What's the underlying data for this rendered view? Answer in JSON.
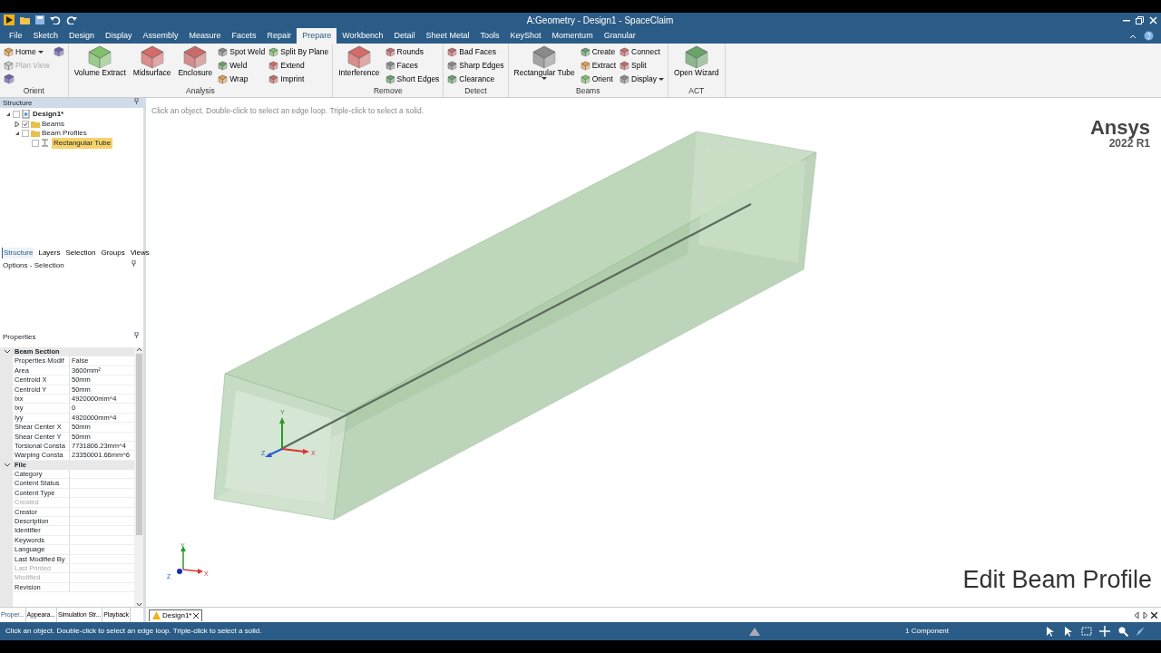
{
  "title_bar": {
    "title": "A:Geometry - Design1 - SpaceClaim"
  },
  "menu_tabs": [
    {
      "label": "File",
      "selected": false
    },
    {
      "label": "Sketch",
      "selected": false
    },
    {
      "label": "Design",
      "selected": false
    },
    {
      "label": "Display",
      "selected": false
    },
    {
      "label": "Assembly",
      "selected": false
    },
    {
      "label": "Measure",
      "selected": false
    },
    {
      "label": "Facets",
      "selected": false
    },
    {
      "label": "Repair",
      "selected": false
    },
    {
      "label": "Prepare",
      "selected": true
    },
    {
      "label": "Workbench",
      "selected": false
    },
    {
      "label": "Detail",
      "selected": false
    },
    {
      "label": "Sheet Metal",
      "selected": false
    },
    {
      "label": "Tools",
      "selected": false
    },
    {
      "label": "KeyShot",
      "selected": false
    },
    {
      "label": "Momentum",
      "selected": false
    },
    {
      "label": "Granular",
      "selected": false
    }
  ],
  "ribbon": [
    {
      "label": "Orient",
      "items": [
        {
          "kind": "small",
          "label": "Home",
          "dropdown": true,
          "disabled": false
        },
        {
          "kind": "small",
          "label": "Plan View",
          "disabled": true
        },
        {
          "kind": "icon",
          "disabled": false
        },
        {
          "kind": "icon",
          "disabled": false
        }
      ]
    },
    {
      "label": "Analysis",
      "items": [
        {
          "kind": "large",
          "label": "Volume Extract"
        },
        {
          "kind": "large",
          "label": "Midsurface"
        },
        {
          "kind": "large",
          "label": "Enclosure"
        },
        {
          "kind": "small",
          "label": "Spot Weld"
        },
        {
          "kind": "small",
          "label": "Weld"
        },
        {
          "kind": "small",
          "label": "Wrap"
        },
        {
          "kind": "small",
          "label": "Split By Plane"
        },
        {
          "kind": "small",
          "label": "Extend"
        },
        {
          "kind": "small",
          "label": "Imprint"
        }
      ]
    },
    {
      "label": "Remove",
      "items": [
        {
          "kind": "large",
          "label": "Interference"
        },
        {
          "kind": "small",
          "label": "Rounds"
        },
        {
          "kind": "small",
          "label": "Faces"
        },
        {
          "kind": "small",
          "label": "Short Edges"
        }
      ]
    },
    {
      "label": "Detect",
      "items": [
        {
          "kind": "small",
          "label": "Bad Faces"
        },
        {
          "kind": "small",
          "label": "Sharp Edges"
        },
        {
          "kind": "small",
          "label": "Clearance"
        }
      ]
    },
    {
      "label": "Beams",
      "items": [
        {
          "kind": "large",
          "label": "Rectangular Tube",
          "dropdown": true
        },
        {
          "kind": "small",
          "label": "Create"
        },
        {
          "kind": "small",
          "label": "Extract"
        },
        {
          "kind": "small",
          "label": "Orient"
        },
        {
          "kind": "small",
          "label": "Connect"
        },
        {
          "kind": "small",
          "label": "Split"
        },
        {
          "kind": "small",
          "label": "Display",
          "dropdown": true
        }
      ]
    },
    {
      "label": "ACT",
      "items": [
        {
          "kind": "large",
          "label": "Open Wizard"
        }
      ]
    }
  ],
  "structure": {
    "title": "Structure",
    "tree": [
      {
        "label": "Design1*",
        "kind": "design",
        "checked": false,
        "expanded": true,
        "selected": false,
        "children": [
          {
            "label": "Beams",
            "kind": "folder",
            "checked": true,
            "expanded": false,
            "selected": false
          },
          {
            "label": "Beam Profiles",
            "kind": "folder",
            "checked": false,
            "expanded": true,
            "selected": false,
            "children": [
              {
                "label": "Rectangular Tube",
                "kind": "profile",
                "checked": false,
                "selected": true
              }
            ]
          }
        ]
      }
    ],
    "tabs": [
      {
        "label": "Structure",
        "selected": true
      },
      {
        "label": "Layers",
        "selected": false
      },
      {
        "label": "Selection",
        "selected": false
      },
      {
        "label": "Groups",
        "selected": false
      },
      {
        "label": "Views",
        "selected": false
      }
    ]
  },
  "options": {
    "title": "Options - Selection"
  },
  "properties": {
    "title": "Properties",
    "sections": [
      {
        "label": "Beam Section",
        "expanded": true,
        "rows": [
          {
            "name": "Properties Modif",
            "value": "False"
          },
          {
            "name": "Area",
            "value": "3600mm²"
          },
          {
            "name": "Centroid X",
            "value": "50mm"
          },
          {
            "name": "Centroid Y",
            "value": "50mm"
          },
          {
            "name": "Ixx",
            "value": "4920000mm^4"
          },
          {
            "name": "Ixy",
            "value": "0"
          },
          {
            "name": "Iyy",
            "value": "4920000mm^4"
          },
          {
            "name": "Shear Center X",
            "value": "50mm"
          },
          {
            "name": "Shear Center Y",
            "value": "50mm"
          },
          {
            "name": "Torsional Consta",
            "value": "7731806.23mm^4"
          },
          {
            "name": "Warping Consta",
            "value": "23350001.66mm^6"
          }
        ]
      },
      {
        "label": "File",
        "expanded": true,
        "rows": [
          {
            "name": "Category",
            "disabled": false
          },
          {
            "name": "Content Status",
            "disabled": false
          },
          {
            "name": "Content Type",
            "disabled": false
          },
          {
            "name": "Created",
            "disabled": true
          },
          {
            "name": "Creator",
            "disabled": false
          },
          {
            "name": "Description",
            "disabled": false
          },
          {
            "name": "Identifier",
            "disabled": false
          },
          {
            "name": "Keywords",
            "disabled": false
          },
          {
            "name": "Language",
            "disabled": false
          },
          {
            "name": "Last Modified By",
            "disabled": false
          },
          {
            "name": "Last Printed",
            "disabled": true
          },
          {
            "name": "Modified",
            "disabled": true
          },
          {
            "name": "Revision",
            "disabled": false
          }
        ]
      }
    ]
  },
  "panel_tabs": [
    {
      "label": "Proper...",
      "selected": true
    },
    {
      "label": "Appeara...",
      "selected": false
    },
    {
      "label": "Simulation Str...",
      "selected": false
    },
    {
      "label": "Playback",
      "selected": false
    }
  ],
  "viewport": {
    "hint": "Click an object. Double-click to select an edge loop. Triple-click to select a solid.",
    "brand": "Ansys",
    "version": "2022 R1",
    "caption": "Edit Beam Profile",
    "axes": [
      "Y",
      "X",
      "Z"
    ],
    "corner_axes": [
      "Y",
      "X",
      "Z"
    ]
  },
  "document_tabs": [
    {
      "label": "Design1*",
      "selected": true
    }
  ],
  "status_bar": {
    "message": "Click an object. Double-click to select an edge loop. Triple-click to select a solid.",
    "selection": "1 Component"
  }
}
